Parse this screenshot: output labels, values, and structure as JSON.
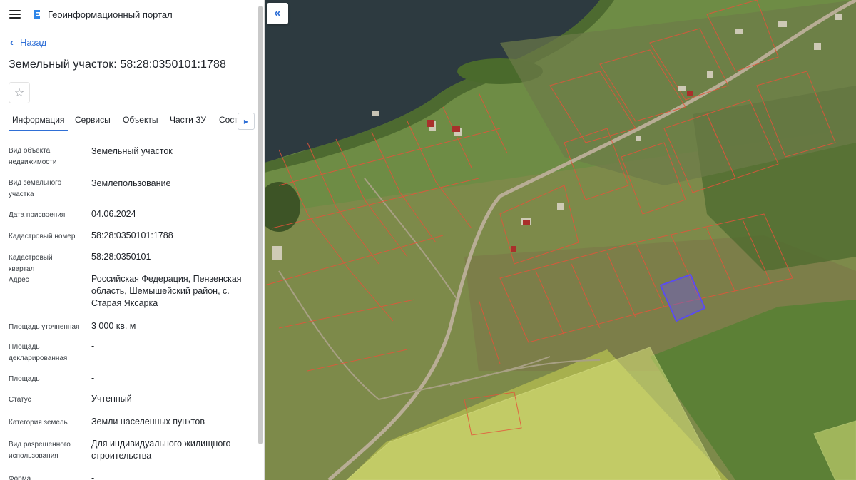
{
  "app": {
    "title": "Геоинформационный портал"
  },
  "nav": {
    "back_label": "Назад"
  },
  "parcel": {
    "title": "Земельный участок: 58:28:0350101:1788"
  },
  "tabs": [
    {
      "label": "Информация",
      "active": true
    },
    {
      "label": "Сервисы",
      "active": false
    },
    {
      "label": "Объекты",
      "active": false
    },
    {
      "label": "Части ЗУ",
      "active": false
    },
    {
      "label": "Соста",
      "active": false
    }
  ],
  "info": [
    {
      "label": "Вид объекта недвижимости",
      "value": "Земельный участок"
    },
    {
      "label": "Вид земельного участка",
      "value": "Землепользование"
    },
    {
      "label": "Дата присвоения",
      "value": "04.06.2024"
    },
    {
      "label": "Кадастровый номер",
      "value": "58:28:0350101:1788"
    },
    {
      "label": "Кадастровый квартал",
      "value": "58:28:0350101"
    },
    {
      "label": "Адрес",
      "value": "Российская Федерация, Пензенская область, Шемышейский район, с. Старая Яксарка"
    },
    {
      "label": "Площадь уточненная",
      "value": "3 000 кв. м"
    },
    {
      "label": "Площадь декларированная",
      "value": "-"
    },
    {
      "label": "Площадь",
      "value": "-"
    },
    {
      "label": "Статус",
      "value": "Учтенный"
    },
    {
      "label": "Категория земель",
      "value": "Земли населенных пунктов"
    },
    {
      "label": "Вид разрешенного использования",
      "value": "Для индивидуального жилищного строительства"
    },
    {
      "label": "Форма собственности",
      "value": "-"
    }
  ],
  "icons": {
    "menu": "menu-icon",
    "logo": "portal-logo-icon",
    "back": "chevron-left-icon",
    "favorite": "star-icon",
    "tabs_next": "chevron-right-icon",
    "collapse": "double-chevron-left-icon"
  },
  "colors": {
    "accent": "#2f6fd6",
    "parcel_border": "#e5533a",
    "selected_parcel": "#5a4cf0",
    "zone_fill": "#d9e27a"
  }
}
